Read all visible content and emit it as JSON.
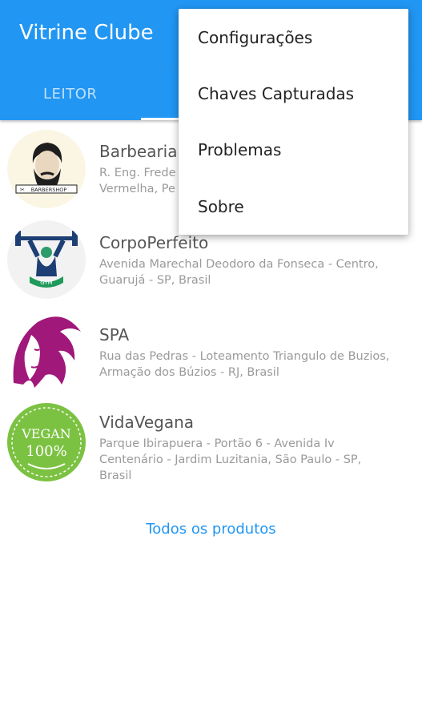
{
  "app": {
    "title": "Vitrine Clube"
  },
  "tabs": [
    {
      "label": "LEITOR"
    }
  ],
  "stores": [
    {
      "name": "Barbearia",
      "address": "R. Eng. Frede\nVermelha, Pe",
      "logo": "barbershop-logo",
      "logo_text": "BARBERSHOP"
    },
    {
      "name": "CorpoPerfeito",
      "address": "Avenida Marechal Deodoro da Fonseca - Centro,\nGuarujá - SP, Brasil",
      "logo": "gym-logo",
      "logo_text": "GYM"
    },
    {
      "name": "SPA",
      "address": "Rua das Pedras - Loteamento Triangulo de Buzios,\nArmação dos Búzios - RJ, Brasil",
      "logo": "spa-logo"
    },
    {
      "name": "VidaVegana",
      "address": "Parque Ibirapuera - Portão 6 - Avenida Iv\nCentenário - Jardim Luzitania, São Paulo - SP,\nBrasil",
      "logo": "vegan-logo",
      "logo_text_1": "VEGAN",
      "logo_text_2": "100%"
    }
  ],
  "footer": {
    "all_products": "Todos os produtos"
  },
  "overflow_menu": {
    "items": [
      {
        "label": "Configurações"
      },
      {
        "label": "Chaves Capturadas"
      },
      {
        "label": "Problemas"
      },
      {
        "label": "Sobre"
      }
    ]
  },
  "colors": {
    "primary": "#2196f3",
    "menu_bg": "#ffffff",
    "title_text": "#555555",
    "address_text": "#9a9a9a"
  }
}
